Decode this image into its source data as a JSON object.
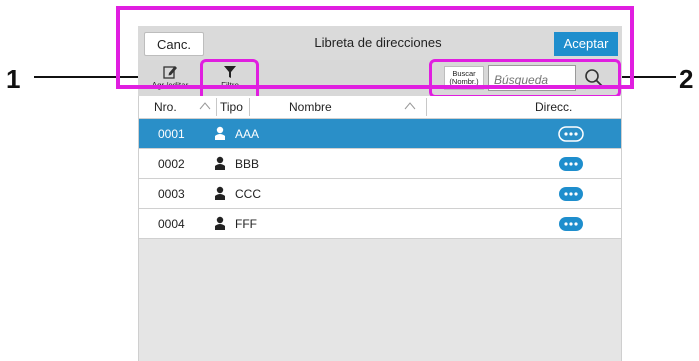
{
  "callouts": {
    "one": "1",
    "two": "2"
  },
  "header": {
    "cancel_label": "Canc.",
    "title": "Libreta de direcciones",
    "accept_label": "Aceptar"
  },
  "toolbar": {
    "add_edit_label": "Agr./editar",
    "filter_label": "Filtro",
    "search_by_line1": "Buscar",
    "search_by_line2": "(Nombr.)",
    "search_placeholder": "Búsqueda"
  },
  "table": {
    "columns": [
      "Nro.",
      "Tipo",
      "Nombre",
      "Direcc."
    ],
    "rows": [
      {
        "nro": "0001",
        "name": "AAA"
      },
      {
        "nro": "0002",
        "name": "BBB"
      },
      {
        "nro": "0003",
        "name": "CCC"
      },
      {
        "nro": "0004",
        "name": "FFF"
      }
    ]
  },
  "colors": {
    "highlight": "#e01ee0",
    "accent": "#1e8ecd",
    "selected_row": "#2a8fc8"
  },
  "icons": [
    "edit-icon",
    "filter-icon",
    "search-icon",
    "person-icon",
    "more-dots-icon",
    "sort-icon"
  ]
}
